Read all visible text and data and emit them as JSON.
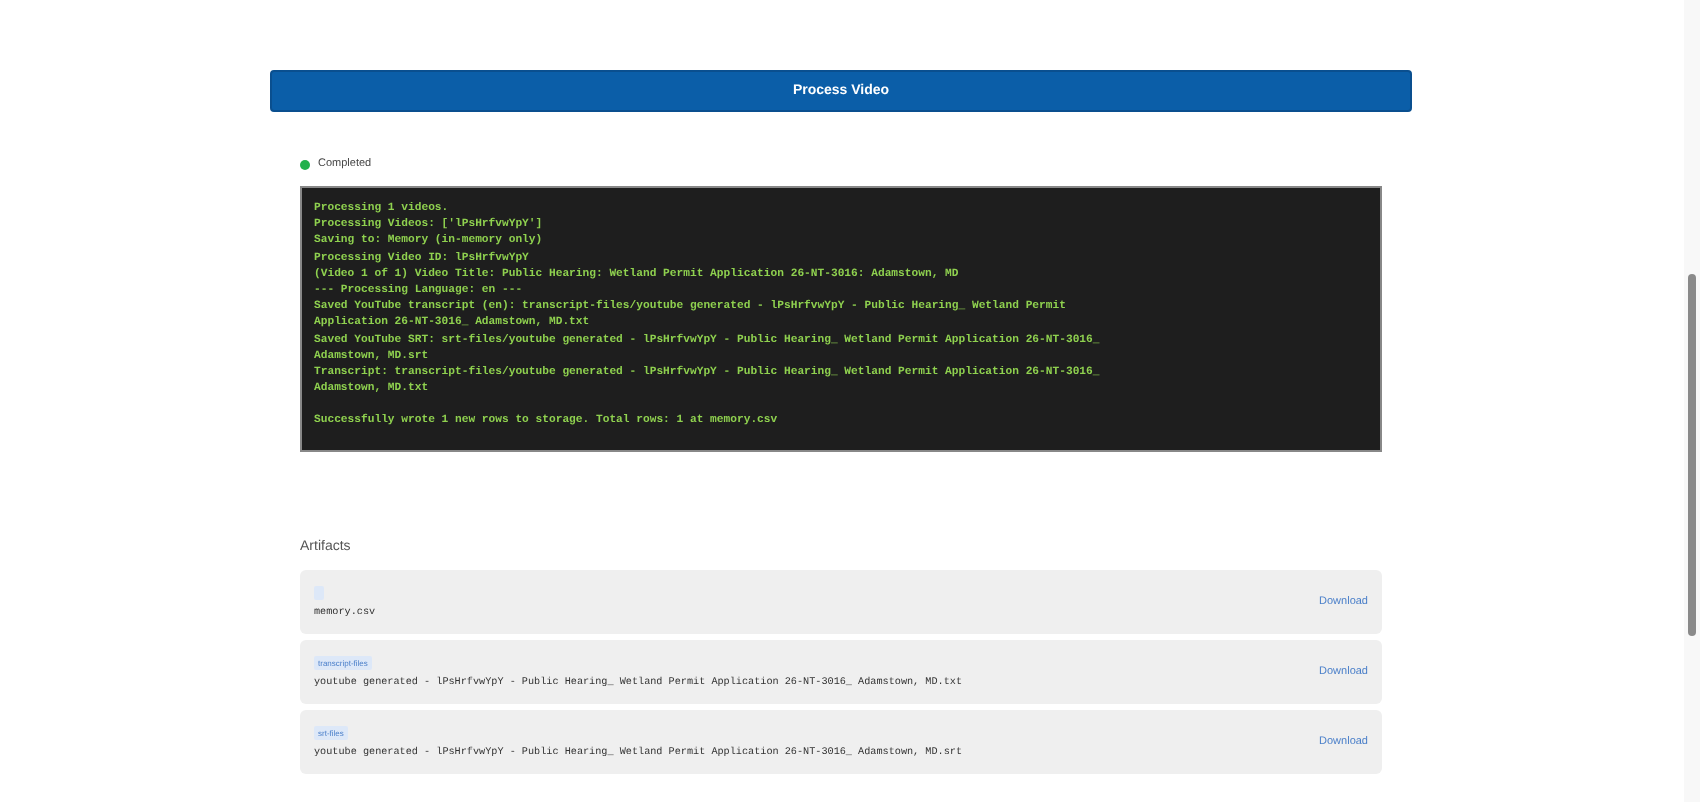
{
  "process_button": {
    "label": "Process Video"
  },
  "status": {
    "label": "Completed",
    "color": "#22b14c"
  },
  "log": {
    "lines": [
      "Processing 1 videos.",
      "Processing Videos: ['lPsHrfvwYpY']",
      "Saving to: Memory (in-memory only)",
      "Processing Video ID: lPsHrfvwYpY",
      "(Video 1 of 1) Video Title: Public Hearing: Wetland Permit Application 26-NT-3016: Adamstown, MD",
      "--- Processing Language: en ---",
      "Saved YouTube transcript (en): transcript-files/youtube generated - lPsHrfvwYpY - Public Hearing_ Wetland Permit",
      "Application 26-NT-3016_ Adamstown, MD.txt",
      "Saved YouTube SRT: srt-files/youtube generated - lPsHrfvwYpY - Public Hearing_ Wetland Permit Application 26-NT-3016_",
      "Adamstown, MD.srt",
      "Transcript: transcript-files/youtube generated - lPsHrfvwYpY - Public Hearing_ Wetland Permit Application 26-NT-3016_",
      "Adamstown, MD.txt"
    ],
    "summary": "Successfully wrote 1 new rows to storage. Total rows: 1 at memory.csv"
  },
  "artifacts": {
    "title": "Artifacts",
    "items": [
      {
        "name": "memory.csv",
        "action": "Download"
      },
      {
        "tag": "transcript-files",
        "name": "youtube generated - lPsHrfvwYpY - Public Hearing_ Wetland Permit Application 26-NT-3016_ Adamstown, MD.txt",
        "action": "Download"
      },
      {
        "tag": "srt-files",
        "name": "youtube generated - lPsHrfvwYpY - Public Hearing_ Wetland Permit Application 26-NT-3016_ Adamstown, MD.srt",
        "action": "Download"
      }
    ]
  }
}
